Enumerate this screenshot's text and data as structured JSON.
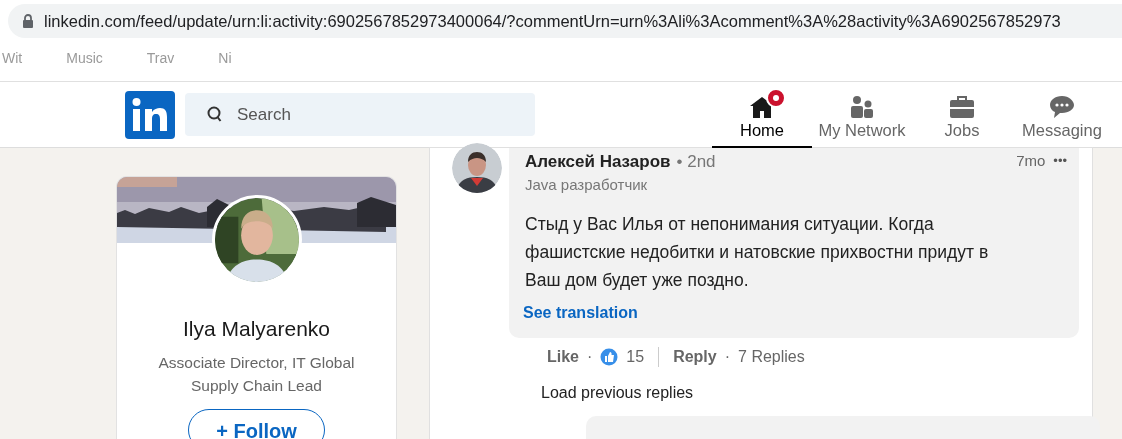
{
  "browser": {
    "url": "linkedin.com/feed/update/urn:li:activity:6902567852973400064/?commentUrn=urn%3Ali%3Acomment%3A%28activity%3A6902567852973",
    "bookmarks": [
      "Wit",
      "Music",
      "Trav",
      "Ni"
    ]
  },
  "header": {
    "search": {
      "placeholder": "Search"
    },
    "nav": [
      {
        "label": "Home",
        "selected": true,
        "badge": true
      },
      {
        "label": "My Network",
        "selected": false,
        "badge": false
      },
      {
        "label": "Jobs",
        "selected": false,
        "badge": false
      },
      {
        "label": "Messaging",
        "selected": false,
        "badge": false
      }
    ]
  },
  "profile": {
    "name": "Ilya Malyarenko",
    "headline": "Associate Director, IT Global Supply Chain Lead",
    "follow": "+ Follow"
  },
  "comment": {
    "author": "Алексей Назаров",
    "degree": "• 2nd",
    "subtitle": "Java разработчик",
    "time": "7mo",
    "menu": "•••",
    "text": "Стыд у Вас Илья от непонимания ситуации. Когда фашистские недобитки и натовские прихвостни придут в Ваш дом будет уже поздно.",
    "translate": "See translation",
    "like": "Like",
    "sep1": "·",
    "reactions": "15",
    "reply": "Reply",
    "sep2": "·",
    "replies": "7 Replies"
  },
  "load_previous": "Load previous replies"
}
